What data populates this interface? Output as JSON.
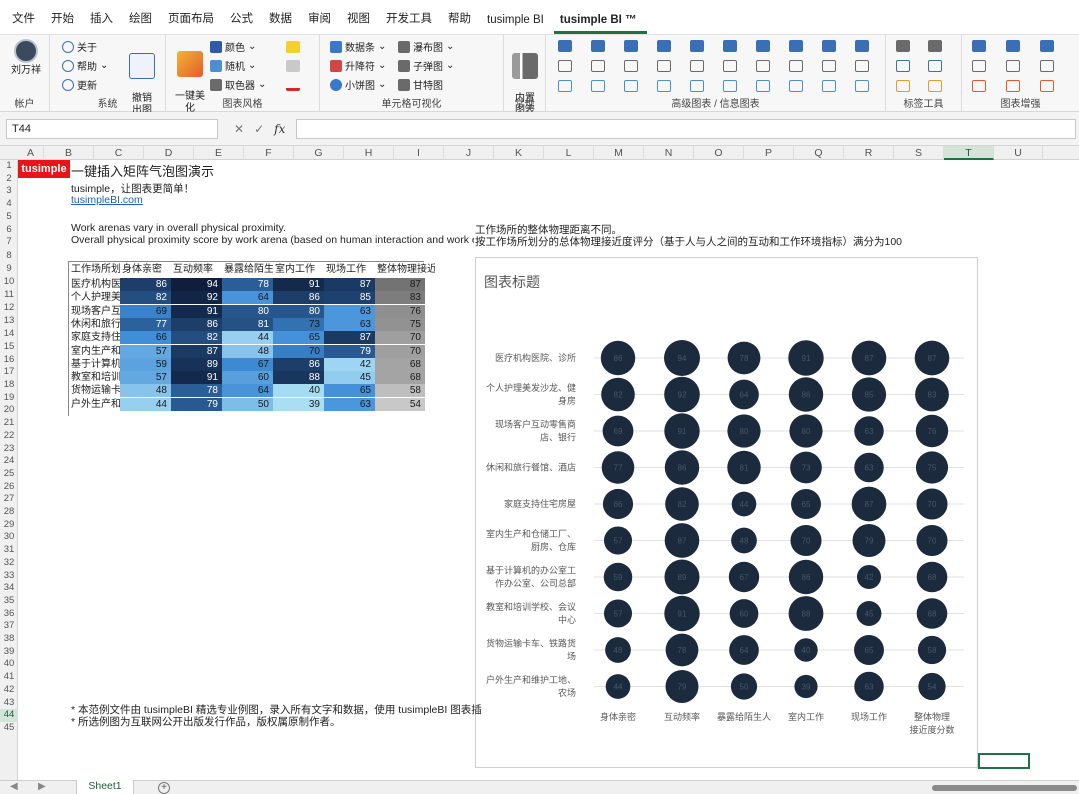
{
  "menu": [
    "文件",
    "开始",
    "插入",
    "绘图",
    "页面布局",
    "公式",
    "数据",
    "审阅",
    "视图",
    "开发工具",
    "帮助",
    "tusimple BI",
    "tusimple BI ™"
  ],
  "ribbon": {
    "account": {
      "user": "刘万祥",
      "label": "帐户"
    },
    "system": {
      "about": "关于",
      "help": "帮助",
      "update": "更新",
      "undo": "撤销\n出图",
      "label": "系统"
    },
    "style": {
      "beautify": "一键美\n化",
      "color": "颜色",
      "random": "随机",
      "picker": "取色器",
      "label": "图表风格"
    },
    "cellviz": {
      "databar": "数据条",
      "updown": "升降符",
      "pie": "小饼图",
      "waterfall": "瀑布图",
      "bullet": "子弹图",
      "gantt": "甘特图",
      "label": "单元格可视化"
    },
    "normal": {
      "builtin": "内置\n图表",
      "label": "常规"
    },
    "advanced": {
      "label": "高级图表 / 信息图表"
    },
    "labeltools": {
      "label": "标签工具"
    },
    "enhance": {
      "label": "图表增强"
    }
  },
  "formula": {
    "namebox": "T44",
    "fx": "fx",
    "cancel": "✕",
    "confirm": "✓"
  },
  "columns": [
    "A",
    "B",
    "C",
    "D",
    "E",
    "F",
    "G",
    "H",
    "I",
    "J",
    "K",
    "L",
    "M",
    "N",
    "O",
    "P",
    "Q",
    "R",
    "S",
    "T",
    "U"
  ],
  "selected_column": "T",
  "selected_row": "44",
  "rows": [
    "1",
    "2",
    "3",
    "4",
    "5",
    "6",
    "7",
    "8",
    "9",
    "10",
    "11",
    "12",
    "13",
    "14",
    "15",
    "16",
    "17",
    "18",
    "19",
    "20",
    "21",
    "22",
    "23",
    "24",
    "25",
    "26",
    "27",
    "28",
    "29",
    "30",
    "31",
    "32",
    "33",
    "34",
    "35",
    "36",
    "37",
    "38",
    "39",
    "40",
    "41",
    "42",
    "43",
    "44",
    "45"
  ],
  "sheet": {
    "logo": "tusimple",
    "title": "一键插入矩阵气泡图演示",
    "subtitle": "tusimple，让图表更简单！",
    "link": "tusimpleBI.com",
    "desc_en_1": "Work arenas vary in overall physical proximity.",
    "desc_en_2": "Overall physical proximity score by work arena (based on human interaction and work er",
    "desc_cn_1": "工作场所的整体物理距离不同。",
    "desc_cn_2": "按工作场所划分的总体物理接近度评分（基于人与人之间的互动和工作环境指标）满分为100",
    "note1": "* 本范例文件由 tusimpleBI 精选专业例图，录入所有文字和数据，使用 tusimpleBI 图表插",
    "note2": "* 所选例图为互联网公开出版发行作品，版权属原制作者。"
  },
  "table": {
    "headers": [
      "工作场所划",
      "身体亲密",
      "互动频率",
      "暴露给陌生",
      "室内工作",
      "现场工作",
      "整体物理接近度分数"
    ],
    "rows": [
      {
        "label": "医疗机构医",
        "values": [
          86,
          94,
          78,
          91,
          87,
          87
        ]
      },
      {
        "label": "个人护理美",
        "values": [
          82,
          92,
          64,
          86,
          85,
          83
        ]
      },
      {
        "label": "现场客户互",
        "values": [
          69,
          91,
          80,
          80,
          63,
          76
        ]
      },
      {
        "label": "休闲和旅行",
        "values": [
          77,
          86,
          81,
          73,
          63,
          75
        ]
      },
      {
        "label": "家庭支持住",
        "values": [
          66,
          82,
          44,
          65,
          87,
          70
        ]
      },
      {
        "label": "室内生产和",
        "values": [
          57,
          87,
          48,
          70,
          79,
          70
        ]
      },
      {
        "label": "基于计算机",
        "values": [
          59,
          89,
          67,
          86,
          42,
          68
        ]
      },
      {
        "label": "教室和培训",
        "values": [
          57,
          91,
          60,
          88,
          45,
          68
        ]
      },
      {
        "label": "货物运输卡",
        "values": [
          48,
          78,
          64,
          40,
          65,
          58
        ]
      },
      {
        "label": "户外生产和",
        "values": [
          44,
          79,
          50,
          39,
          63,
          54
        ]
      }
    ]
  },
  "chart_data": {
    "type": "scatter",
    "title": "图表标题",
    "categories": [
      "医疗机构医院、诊所",
      "个人护理美发沙龙、健身房",
      "现场客户互动零售商店、银行",
      "休闲和旅行餐馆、酒店",
      "家庭支持住宅房屋",
      "室内生产和仓储工厂、厨房、仓库",
      "基于计算机的办公室工作办公室、公司总部",
      "教室和培训学校、会议中心",
      "货物运输卡车、铁路货场",
      "户外生产和维护工地、农场"
    ],
    "category_lines": [
      [
        "医疗机构医院、诊所"
      ],
      [
        "个人护理美发沙龙、健",
        "身房"
      ],
      [
        "现场客户互动零售商",
        "店、银行"
      ],
      [
        "休闲和旅行餐馆、酒店"
      ],
      [
        "家庭支持住宅房屋"
      ],
      [
        "室内生产和仓储工厂、",
        "厨房、仓库"
      ],
      [
        "基于计算机的办公室工",
        "作办公室、公司总部"
      ],
      [
        "教室和培训学校、会议",
        "中心"
      ],
      [
        "货物运输卡车、铁路货",
        "场"
      ],
      [
        "户外生产和维护工地、",
        "农场"
      ]
    ],
    "x_labels": [
      [
        "身体亲密"
      ],
      [
        "互动频率"
      ],
      [
        "暴露给陌生人"
      ],
      [
        "室内工作"
      ],
      [
        "现场工作"
      ],
      [
        "整体物理",
        "接近度分数"
      ]
    ],
    "series": [
      {
        "values": [
          86,
          94,
          78,
          91,
          87,
          87
        ]
      },
      {
        "values": [
          82,
          92,
          64,
          86,
          85,
          83
        ]
      },
      {
        "values": [
          69,
          91,
          80,
          80,
          63,
          76
        ]
      },
      {
        "values": [
          77,
          86,
          81,
          73,
          63,
          75
        ]
      },
      {
        "values": [
          66,
          82,
          44,
          65,
          87,
          70
        ]
      },
      {
        "values": [
          57,
          87,
          48,
          70,
          79,
          70
        ]
      },
      {
        "values": [
          59,
          89,
          67,
          86,
          42,
          68
        ]
      },
      {
        "values": [
          57,
          91,
          60,
          88,
          45,
          68
        ]
      },
      {
        "values": [
          48,
          78,
          64,
          40,
          65,
          58
        ]
      },
      {
        "values": [
          44,
          79,
          50,
          39,
          63,
          54
        ]
      }
    ],
    "bubble_color": "#1b2a3c",
    "label_color": "#4a5668"
  },
  "tabs": {
    "sheet1": "Sheet1",
    "add": "+"
  }
}
